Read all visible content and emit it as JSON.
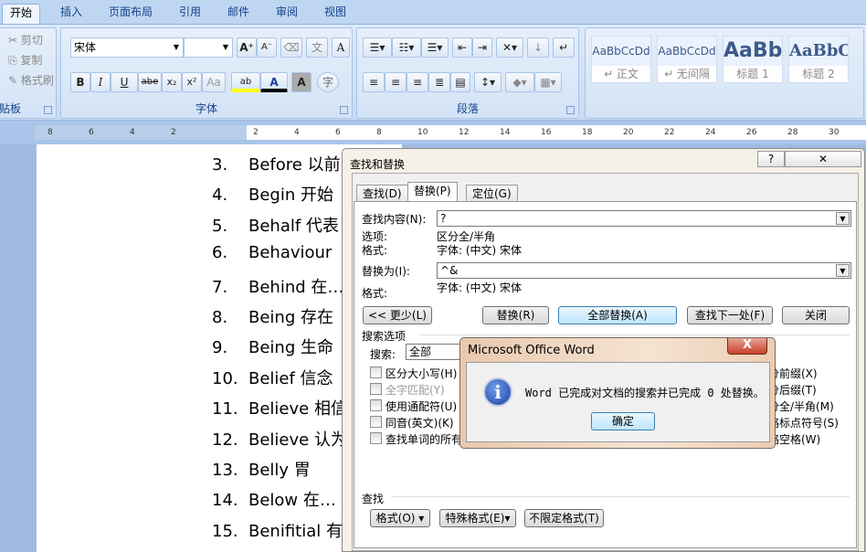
{
  "ribbon_tabs": [
    "开始",
    "插入",
    "页面布局",
    "引用",
    "邮件",
    "审阅",
    "视图"
  ],
  "clipboard": {
    "cut": "剪切",
    "copy": "复制",
    "format_painter": "格式刷",
    "label": "贴板"
  },
  "font": {
    "name": "宋体",
    "size": "",
    "label": "字体",
    "bold": "B",
    "italic": "I",
    "underline": "U",
    "strike": "abe",
    "sub": "x₂",
    "sup": "x²",
    "case": "Aa",
    "grow": "A⁺",
    "shrink": "A⁻",
    "char_a": "A",
    "highlight": "ab",
    "color": "A",
    "shade": "A",
    "enclose": "字",
    "phonetic": "文"
  },
  "paragraph": {
    "label": "段落"
  },
  "styles": [
    {
      "sample": "AaBbCcDd",
      "name": "↵ 正文"
    },
    {
      "sample": "AaBbCcDd",
      "name": "↵ 无间隔"
    },
    {
      "sample": "AaBb",
      "name": "标题 1"
    },
    {
      "sample": "AaBbC",
      "name": "标题 2"
    }
  ],
  "ruler_ticks": [
    "8",
    "6",
    "4",
    "2",
    "2",
    "4",
    "6",
    "8",
    "10",
    "12",
    "14",
    "16",
    "18",
    "20",
    "22",
    "24",
    "26",
    "28",
    "30"
  ],
  "document_lines": [
    {
      "num": "3.",
      "text": "Before 以前"
    },
    {
      "num": "4.",
      "text": "Begin 开始"
    },
    {
      "num": "5.",
      "text": "Behalf 代表"
    },
    {
      "num": "6.",
      "text": "Behaviour"
    },
    {
      "num": "7.",
      "text": "Behind 在…"
    },
    {
      "num": "8.",
      "text": "Being 存在"
    },
    {
      "num": "9.",
      "text": "Being 生命"
    },
    {
      "num": "10.",
      "text": "Belief 信念"
    },
    {
      "num": "11.",
      "text": "Believe 相信"
    },
    {
      "num": "12.",
      "text": "Believe 认为"
    },
    {
      "num": "13.",
      "text": "Belly 胃"
    },
    {
      "num": "14.",
      "text": "Below 在…"
    },
    {
      "num": "15.",
      "text": "Benifitial 有"
    }
  ],
  "dialog": {
    "title": "查找和替换",
    "help": "?",
    "close": "✕",
    "tabs": [
      "查找(D)",
      "替换(P)",
      "定位(G)"
    ],
    "find_label": "查找内容(N):",
    "find_value": "?",
    "options_label": "选项:",
    "options_value": "区分全/半角",
    "format_label": "格式:",
    "find_format": "字体: (中文) 宋体",
    "replace_label": "替换为(I):",
    "replace_value": "^&",
    "replace_format_label": "格式:",
    "replace_format": "字体: (中文) 宋体",
    "buttons": {
      "less": "<< 更少(L)",
      "replace": "替换(R)",
      "replace_all": "全部替换(A)",
      "find_next": "查找下一处(F)",
      "close": "关闭"
    },
    "search_options": "搜索选项",
    "search_label": "搜索:",
    "search_value": "全部",
    "left_checks": [
      "区分大小写(H)",
      "全字匹配(Y)",
      "使用通配符(U)",
      "同音(英文)(K)",
      "查找单词的所有形式(英文)(W)"
    ],
    "right_checks": [
      "区分前缀(X)",
      "区分后缀(T)",
      "区分全/半角(M)",
      "忽略标点符号(S)",
      "忽略空格(W)"
    ],
    "find_section": "查找",
    "bottom_buttons": [
      "格式(O) ▾",
      "特殊格式(E)▾",
      "不限定格式(T)"
    ]
  },
  "message": {
    "title": "Microsoft Office Word",
    "text": "Word 已完成对文档的搜索并已完成 0 处替换。",
    "ok": "确定",
    "close": "X"
  }
}
